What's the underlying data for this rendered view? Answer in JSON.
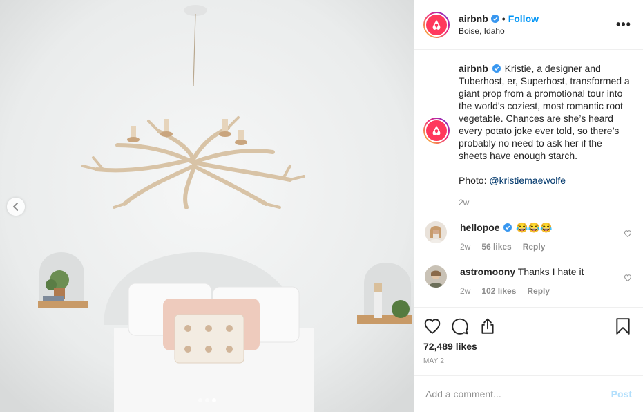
{
  "header": {
    "username": "airbnb",
    "separator": "•",
    "follow_label": "Follow",
    "location": "Boise, Idaho",
    "more_label": "•••"
  },
  "caption": {
    "username": "airbnb",
    "text": "Kristie, a designer and Tuberhost, er, Superhost, transformed a giant prop from a promotional tour into the world’s coziest, most romantic root vegetable. Chances are she’s heard every potato joke ever told, so there’s probably no need to ask her if the sheets have enough starch.",
    "photo_prefix": "Photo: ",
    "photo_mention": "@kristiemaewolfe",
    "time": "2w"
  },
  "comments": [
    {
      "username": "hellopoe",
      "text": "😂😂😂",
      "time": "2w",
      "likes": "56 likes",
      "reply_label": "Reply"
    },
    {
      "username": "astromoony",
      "text": "Thanks I hate it",
      "time": "2w",
      "likes": "102 likes",
      "reply_label": "Reply"
    }
  ],
  "footer": {
    "likes": "72,489 likes",
    "date": "MAY 2",
    "comment_placeholder": "Add a comment...",
    "post_label": "Post"
  },
  "colors": {
    "brand": "#ff385c",
    "link": "#0095f6",
    "muted": "#8e8e8e",
    "post_disabled": "#b2dffc"
  },
  "icons": [
    "airbnb-logo-icon",
    "verified-badge-icon",
    "more-options-icon",
    "heart-icon",
    "comment-icon",
    "share-icon",
    "bookmark-icon",
    "chevron-left-icon"
  ]
}
